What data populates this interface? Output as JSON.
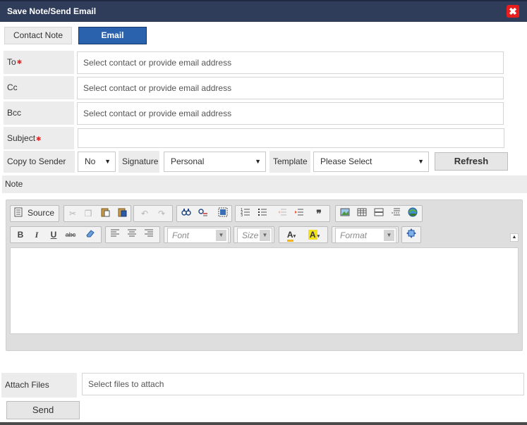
{
  "dialog": {
    "title": "Save Note/Send Email",
    "close_glyph": "✖",
    "close_color": "#e81e1e",
    "header_color": "#2f3d5a"
  },
  "tabs": {
    "contact_note": "Contact Note",
    "email": "Email",
    "active": "email",
    "active_color": "#2b62ad"
  },
  "to": {
    "label": "To",
    "required_mark": "✱",
    "placeholder": "Select contact or provide email address"
  },
  "cc": {
    "label": "Cc",
    "placeholder": "Select contact or provide email address"
  },
  "bcc": {
    "label": "Bcc",
    "placeholder": "Select contact or provide email address"
  },
  "subject": {
    "label": "Subject",
    "required_mark": "✱",
    "value": ""
  },
  "options": {
    "copy_to_sender_label": "Copy to Sender",
    "copy_to_sender_value": "No",
    "signature_label": "Signature",
    "signature_value": "Personal",
    "template_label": "Template",
    "template_value": "Please Select",
    "refresh_label": "Refresh",
    "dropdown_arrow": "▼"
  },
  "note": {
    "label": "Note"
  },
  "toolbar": {
    "source_label": "Source",
    "font_placeholder": "Font",
    "size_placeholder": "Size",
    "format_placeholder": "Format",
    "bold": "B",
    "italic": "I",
    "underline": "U",
    "strike": "abc",
    "icons": [
      "source-icon",
      "cut-icon",
      "copy-icon",
      "paste-icon",
      "paste-text-icon",
      "paste-word-icon",
      "undo-icon",
      "redo-icon",
      "find-icon",
      "replace-icon",
      "select-all-icon",
      "numbered-list-icon",
      "bulleted-list-icon",
      "outdent-icon",
      "indent-icon",
      "blockquote-icon",
      "image-icon",
      "table-icon",
      "horizontal-line-icon",
      "page-break-icon",
      "link-icon",
      "bold-icon",
      "italic-icon",
      "underline-icon",
      "strikethrough-icon",
      "remove-format-icon",
      "align-left-icon",
      "align-center-icon",
      "align-right-icon",
      "text-color-icon",
      "background-color-icon",
      "maximize-icon",
      "collapse-toolbar-icon"
    ]
  },
  "attach": {
    "label": "Attach Files",
    "placeholder": "Select files to attach"
  },
  "send": {
    "label": "Send"
  }
}
